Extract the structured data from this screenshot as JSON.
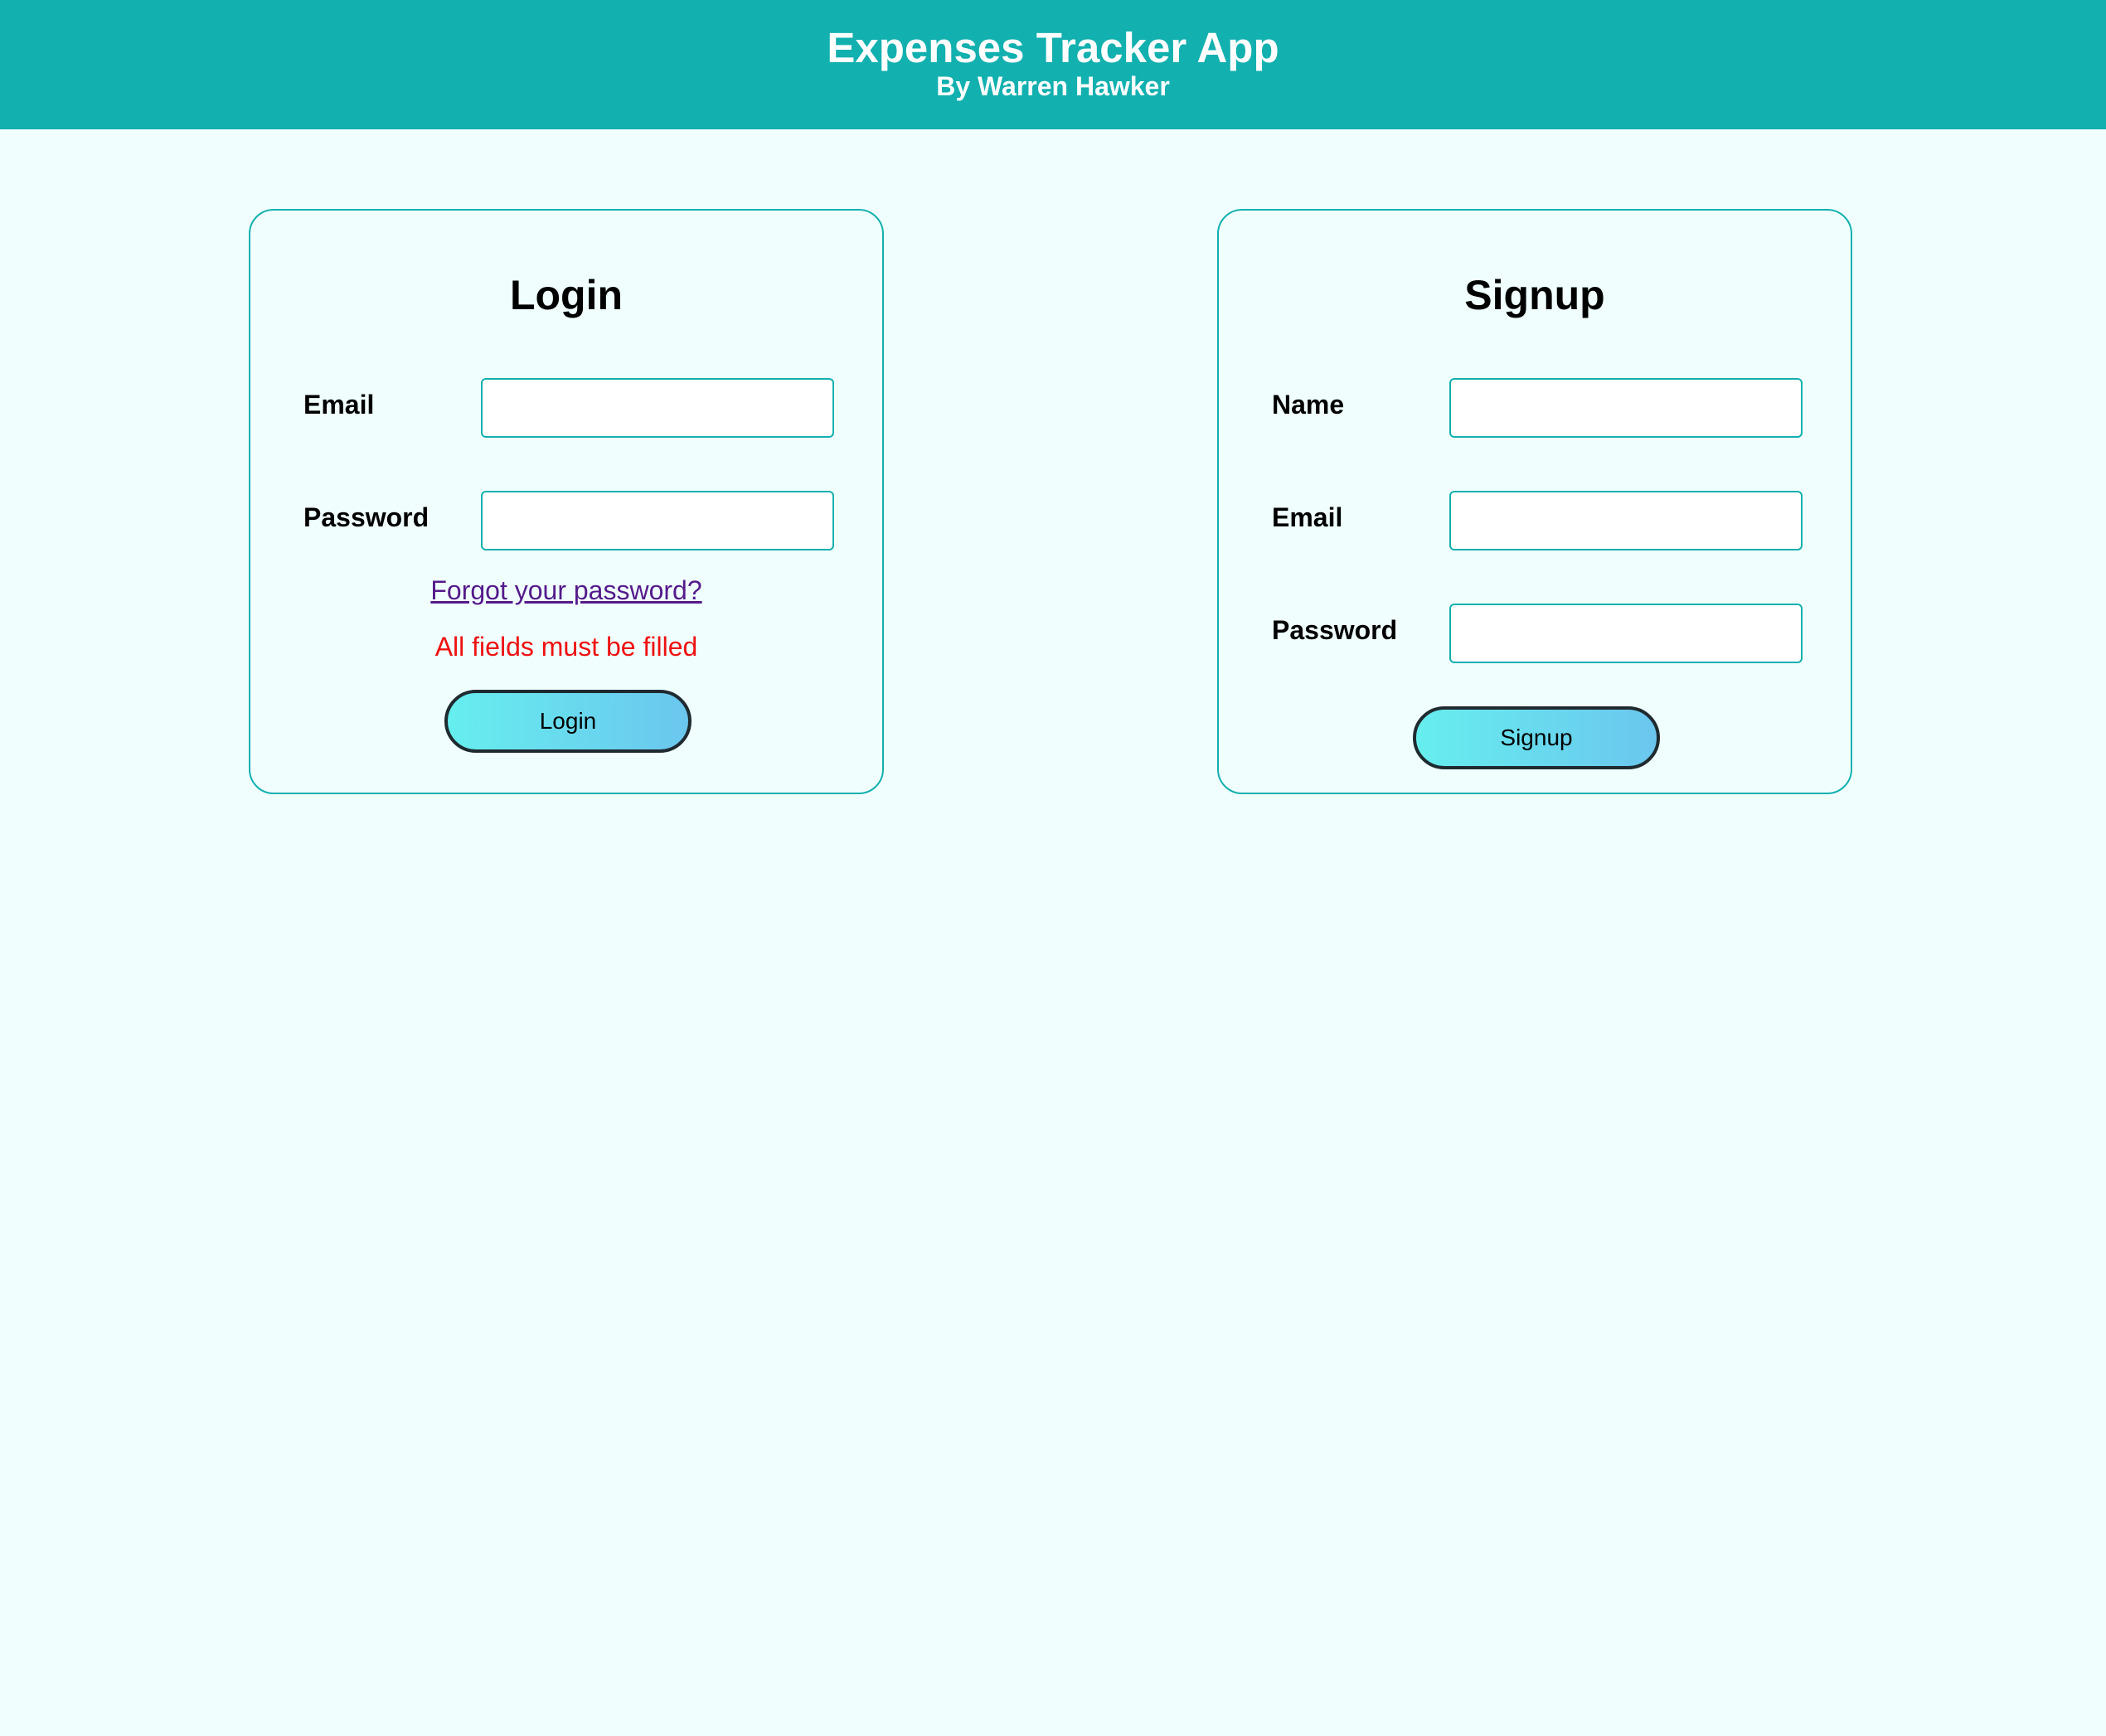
{
  "header": {
    "title": "Expenses Tracker App",
    "subtitle": "By Warren Hawker"
  },
  "login": {
    "title": "Login",
    "email_label": "Email",
    "password_label": "Password",
    "forgot_link": "Forgot your password?",
    "error_message": "All fields must be filled",
    "button_label": "Login"
  },
  "signup": {
    "title": "Signup",
    "name_label": "Name",
    "email_label": "Email",
    "password_label": "Password",
    "button_label": "Signup"
  },
  "colors": {
    "header_bg": "#12b0af",
    "page_bg": "#f0fffe",
    "error": "#ee1111",
    "link": "#551a8b"
  }
}
